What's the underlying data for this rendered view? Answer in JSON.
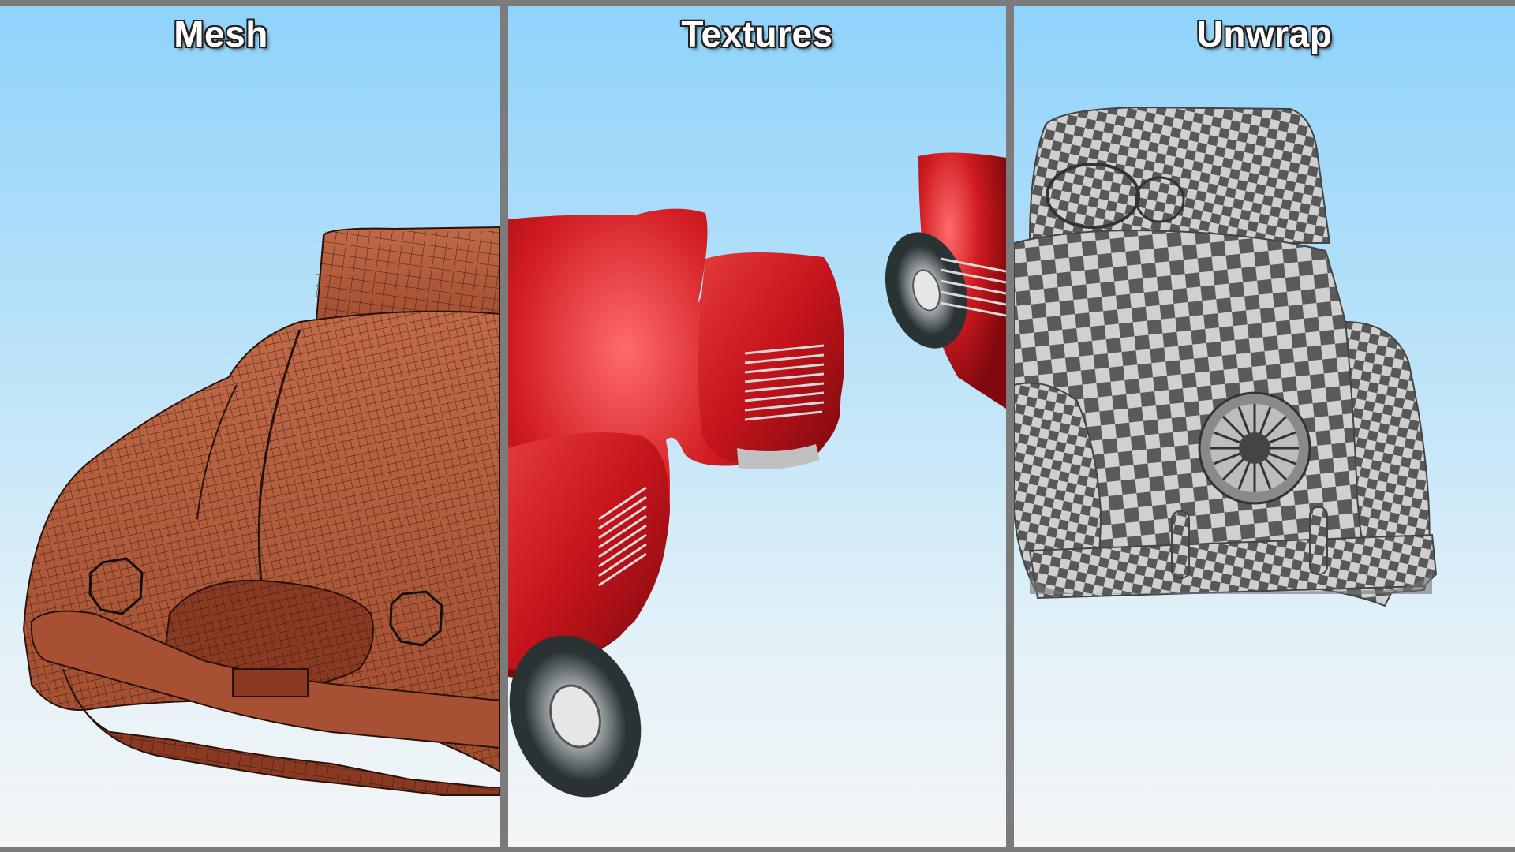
{
  "panels": [
    {
      "id": "mesh",
      "title": "Mesh"
    },
    {
      "id": "textures",
      "title": "Textures"
    },
    {
      "id": "unwrap",
      "title": "Unwrap"
    }
  ],
  "colors": {
    "frame": "#7b7b7b",
    "sky_top": "#8fd3fb",
    "sky_bottom": "#f3f5f6",
    "mesh_body": "#b45a3a",
    "mesh_wire": "#2a120a",
    "car_red": "#c8141a",
    "interior_beige": "#e6d2bd",
    "checker_dark": "#5a5a5a",
    "checker_light": "#d0d0d0"
  },
  "icons": {
    "mesh": "wireframe-car-render",
    "textures": "red-car-render",
    "unwrap": "checker-car-render"
  }
}
